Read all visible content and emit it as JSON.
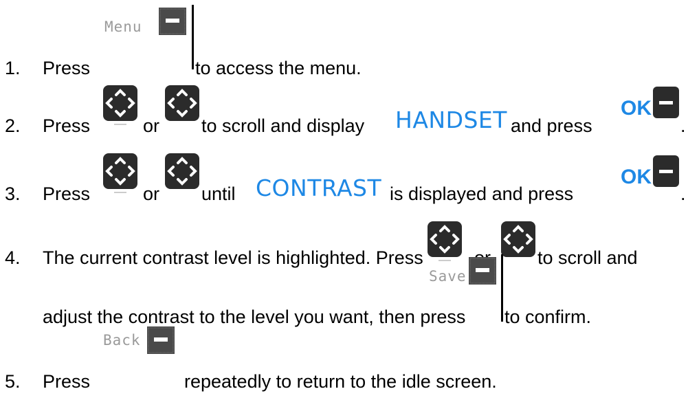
{
  "steps": [
    {
      "num": "1.",
      "t1": "Press",
      "key_label": "Menu",
      "t2": "to access the menu."
    },
    {
      "num": "2.",
      "t1": "Press",
      "or": "or",
      "t2": "to scroll and display",
      "highlight": "HANDSET",
      "t3": "and press",
      "ok_label": "OK",
      "end": "."
    },
    {
      "num": "3.",
      "t1": "Press",
      "or": "or",
      "t2": "until",
      "highlight": "CONTRAST",
      "t3": "is displayed and press",
      "ok_label": "OK",
      "end": "."
    },
    {
      "num": "4.",
      "t1": "The current contrast level is highlighted.  Press",
      "or": "or",
      "t2": "to scroll and",
      "t3": "adjust the contrast to the level you want, then press",
      "key_label": "Save",
      "t4": "to confirm."
    },
    {
      "num": "5.",
      "t1": "Press",
      "key_label": "Back",
      "t2": "repeatedly to return to the idle screen."
    }
  ],
  "colors": {
    "highlight": "#1e88e5",
    "key_gray": "#9a9a9a"
  },
  "icons": {
    "nav": "navigation-key-icon",
    "soft": "softkey-icon",
    "ok": "ok-key-icon"
  }
}
